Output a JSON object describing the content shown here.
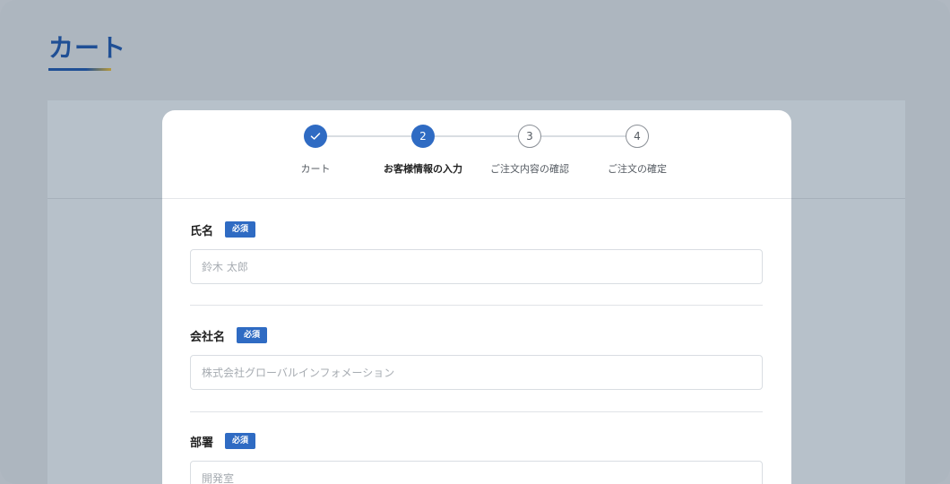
{
  "page": {
    "title": "カート"
  },
  "stepper": {
    "steps": [
      {
        "number": "",
        "label": "カート",
        "state": "done"
      },
      {
        "number": "2",
        "label": "お客様情報の入力",
        "state": "active"
      },
      {
        "number": "3",
        "label": "ご注文内容の確認",
        "state": "todo"
      },
      {
        "number": "4",
        "label": "ご注文の確定",
        "state": "todo"
      }
    ]
  },
  "form": {
    "required_badge": "必須",
    "fields": [
      {
        "label": "氏名",
        "placeholder": "鈴木 太郎",
        "value": ""
      },
      {
        "label": "会社名",
        "placeholder": "株式会社グローバルインフォメーション",
        "value": ""
      },
      {
        "label": "部署",
        "placeholder": "開発室",
        "value": ""
      }
    ]
  },
  "colors": {
    "accent": "#2f6bc3",
    "title": "#1f4f95",
    "underline_gold": "#b89a3c"
  }
}
